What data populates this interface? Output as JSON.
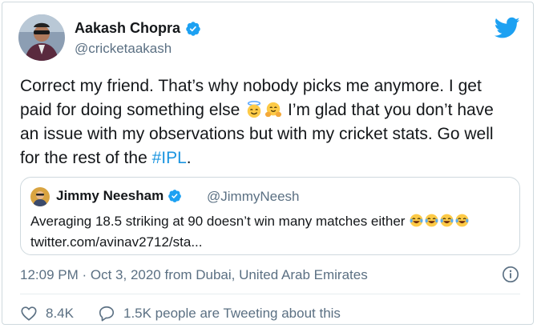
{
  "tweet": {
    "author": {
      "name": "Aakash Chopra",
      "handle": "@cricketaakash",
      "verified": true
    },
    "text_parts": {
      "line_a": "Correct my friend. That’s why nobody picks me anymore. I get paid for doing something else ",
      "line_b": " I’m glad that you don’t have an issue with my observations but with my cricket stats. Go well for the rest of the ",
      "hashtag": "#IPL",
      "end": "."
    },
    "emojis": [
      "smiling-face-with-halo",
      "hugging-face"
    ],
    "timestamp": "12:09 PM · Oct 3, 2020 from Dubai, United Arab Emirates",
    "likes": "8.4K",
    "tweeting_about": "1.5K people are Tweeting about this"
  },
  "quoted_tweet": {
    "author": {
      "name": "Jimmy Neesham",
      "handle": "@JimmyNeesh",
      "verified": true
    },
    "text": "Averaging 18.5 striking at 90 doesn’t win many matches either ",
    "emojis": [
      "face-with-tears-of-joy",
      "face-with-tears-of-joy",
      "face-with-tears-of-joy",
      "face-with-tears-of-joy"
    ],
    "link": "twitter.com/avinav2712/sta..."
  },
  "colors": {
    "text": "#14171a",
    "secondary": "#5b7083",
    "accent": "#1b95e0",
    "verified": "#1da1f2",
    "border": "#cfd9de"
  }
}
